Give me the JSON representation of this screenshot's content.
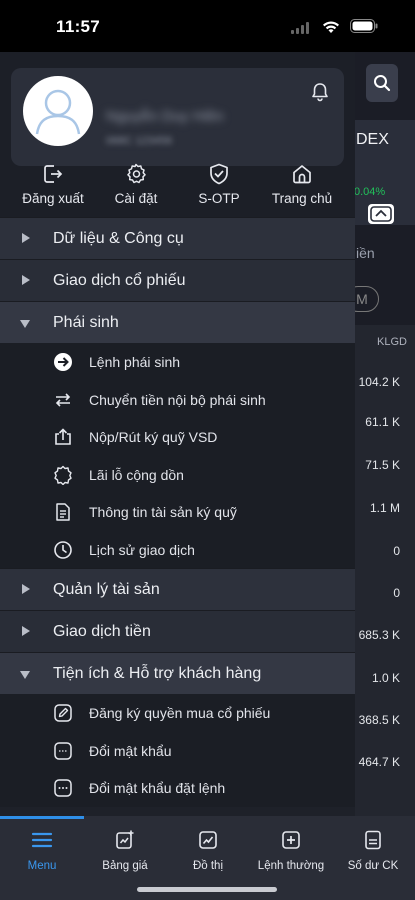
{
  "status_bar": {
    "time": "11:57"
  },
  "background_screen": {
    "index_label": "DEX",
    "index_change": "0.04%",
    "tab_fragment": "iền",
    "filter_chip": "M",
    "column_header": "KLGD",
    "values": [
      "104.2 K",
      "61.1 K",
      "71.5 K",
      "1.1 M",
      "0",
      "0",
      "685.3 K",
      "1.0 K",
      "368.5 K",
      "464.7 K"
    ]
  },
  "profile": {
    "name": "Nguyễn Duy Hiền",
    "account": "068C 123456"
  },
  "quick_actions": [
    {
      "label": "Đăng xuất",
      "icon": "logout-icon"
    },
    {
      "label": "Cài đặt",
      "icon": "gear-icon"
    },
    {
      "label": "S-OTP",
      "icon": "shield-check-icon"
    },
    {
      "label": "Trang chủ",
      "icon": "home-icon"
    }
  ],
  "menu": {
    "sections": [
      {
        "title": "Dữ liệu & Công cụ",
        "expanded": false
      },
      {
        "title": "Giao dịch cổ phiếu",
        "expanded": false
      },
      {
        "title": "Phái sinh",
        "expanded": true
      },
      {
        "title": "Quản lý tài sản",
        "expanded": false
      },
      {
        "title": "Giao dịch tiền",
        "expanded": false
      },
      {
        "title": "Tiện ích & Hỗ trợ khách hàng",
        "expanded": true
      }
    ],
    "derivatives_items": [
      {
        "label": "Lệnh phái sinh",
        "icon": "arrow-circle-right-icon"
      },
      {
        "label": "Chuyển tiền nội bộ phái sinh",
        "icon": "transfer-arrows-icon"
      },
      {
        "label": "Nộp/Rút ký quỹ VSD",
        "icon": "upload-box-icon"
      },
      {
        "label": "Lãi lỗ cộng dồn",
        "icon": "badge-icon"
      },
      {
        "label": "Thông tin tài sản ký quỹ",
        "icon": "document-icon"
      },
      {
        "label": "Lịch sử giao dịch",
        "icon": "clock-icon"
      }
    ],
    "utility_items": [
      {
        "label": "Đăng ký quyền mua cổ phiếu",
        "icon": "edit-icon"
      },
      {
        "label": "Đổi mật khẩu",
        "icon": "password-icon"
      },
      {
        "label": "Đổi mật khẩu đặt lệnh",
        "icon": "password-dots-icon"
      }
    ]
  },
  "tabbar": {
    "active": "Menu",
    "tabs": [
      {
        "label": "Menu",
        "icon": "menu-icon"
      },
      {
        "label": "Bảng giá",
        "icon": "price-board-icon"
      },
      {
        "label": "Đồ thị",
        "icon": "chart-icon"
      },
      {
        "label": "Lệnh thường",
        "icon": "plus-box-icon"
      },
      {
        "label": "Số dư CK",
        "icon": "balance-icon"
      }
    ]
  },
  "colors": {
    "accent": "#2f8fe8",
    "drawer_bg": "#1e2129",
    "section_bg": "#2d313c",
    "positive": "#21c05a"
  }
}
